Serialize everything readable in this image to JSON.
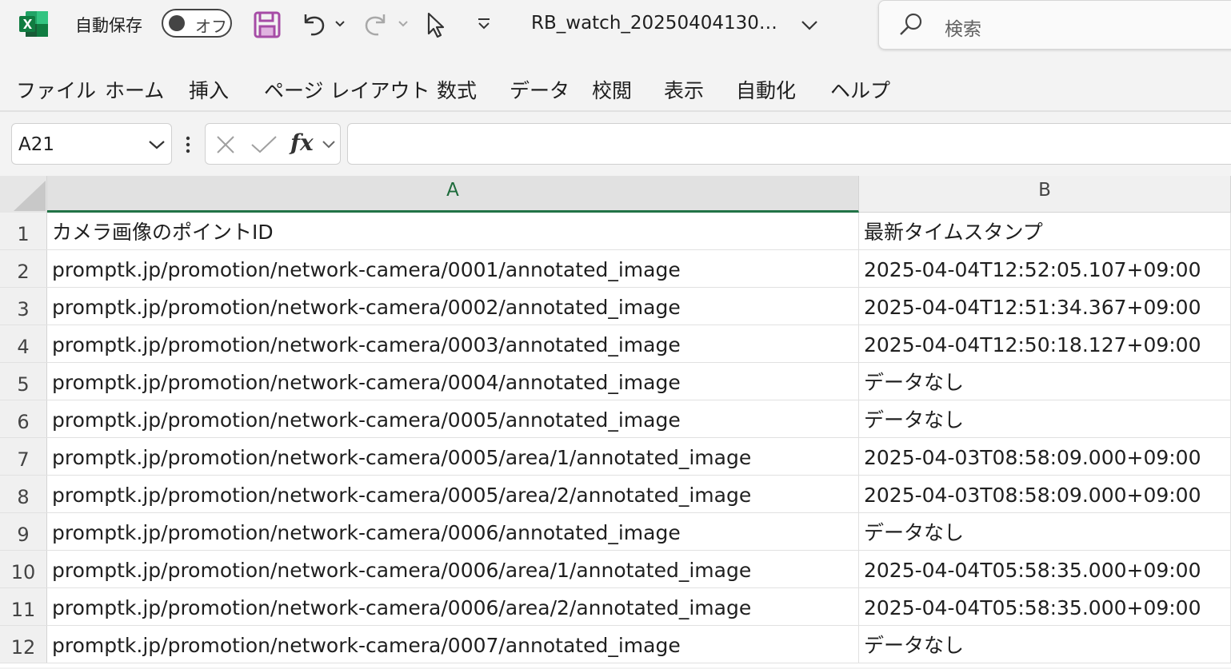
{
  "titlebar": {
    "autosave_label": "自動保存",
    "autosave_state": "オフ",
    "document_title": "RB_watch_20250404130…",
    "search_placeholder": "検索"
  },
  "ribbon": {
    "tabs": [
      "ファイル",
      "ホーム",
      "挿入",
      "ページ レイアウト",
      "数式",
      "データ",
      "校閲",
      "表示",
      "自動化",
      "ヘルプ"
    ]
  },
  "formula_bar": {
    "name_box": "A21",
    "fx_label": "fx",
    "formula": ""
  },
  "sheet": {
    "columns": [
      "A",
      "B"
    ],
    "active_column": "A",
    "rows": [
      {
        "num": "1",
        "a": "カメラ画像のポイントID",
        "b": "最新タイムスタンプ"
      },
      {
        "num": "2",
        "a": "promptk.jp/promotion/network-camera/0001/annotated_image",
        "b": "2025-04-04T12:52:05.107+09:00"
      },
      {
        "num": "3",
        "a": "promptk.jp/promotion/network-camera/0002/annotated_image",
        "b": "2025-04-04T12:51:34.367+09:00"
      },
      {
        "num": "4",
        "a": "promptk.jp/promotion/network-camera/0003/annotated_image",
        "b": "2025-04-04T12:50:18.127+09:00"
      },
      {
        "num": "5",
        "a": "promptk.jp/promotion/network-camera/0004/annotated_image",
        "b": "データなし"
      },
      {
        "num": "6",
        "a": "promptk.jp/promotion/network-camera/0005/annotated_image",
        "b": "データなし"
      },
      {
        "num": "7",
        "a": "promptk.jp/promotion/network-camera/0005/area/1/annotated_image",
        "b": "2025-04-03T08:58:09.000+09:00"
      },
      {
        "num": "8",
        "a": "promptk.jp/promotion/network-camera/0005/area/2/annotated_image",
        "b": "2025-04-03T08:58:09.000+09:00"
      },
      {
        "num": "9",
        "a": "promptk.jp/promotion/network-camera/0006/annotated_image",
        "b": "データなし"
      },
      {
        "num": "10",
        "a": "promptk.jp/promotion/network-camera/0006/area/1/annotated_image",
        "b": "2025-04-04T05:58:35.000+09:00"
      },
      {
        "num": "11",
        "a": "promptk.jp/promotion/network-camera/0006/area/2/annotated_image",
        "b": "2025-04-04T05:58:35.000+09:00"
      },
      {
        "num": "12",
        "a": "promptk.jp/promotion/network-camera/0007/annotated_image",
        "b": "データなし"
      }
    ]
  },
  "colors": {
    "excel_green": "#217346",
    "save_icon": "#a64ca6",
    "active_header_text": "#1d6b3b"
  },
  "icons": [
    "excel-logo-icon",
    "save-icon",
    "undo-icon",
    "redo-icon",
    "touch-mode-icon",
    "customize-toolbar-icon",
    "search-icon",
    "cancel-icon",
    "enter-icon",
    "insert-function-icon"
  ]
}
